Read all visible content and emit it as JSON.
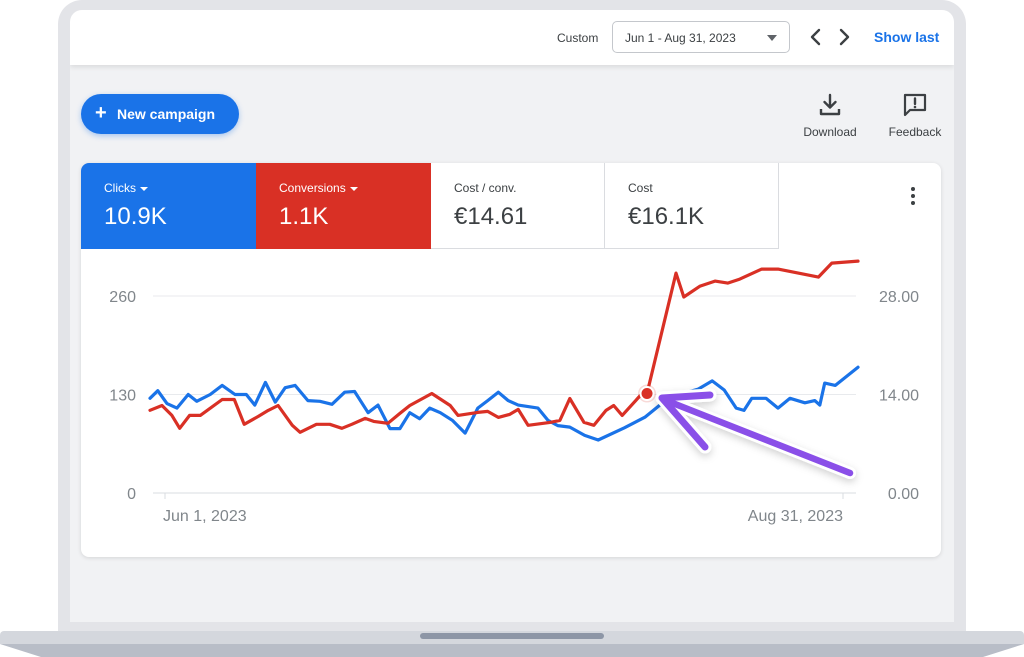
{
  "header": {
    "range_label": "Custom",
    "date_range": "Jun 1 - Aug 31, 2023",
    "show_last": "Show last"
  },
  "toolbar": {
    "new_campaign": "New campaign",
    "download": "Download",
    "feedback": "Feedback"
  },
  "metrics": [
    {
      "name": "Clicks",
      "value": "10.9K",
      "color": "#1a73e8",
      "selected": true
    },
    {
      "name": "Conversions",
      "value": "1.1K",
      "color": "#d93025",
      "selected": true
    },
    {
      "name": "Cost / conv.",
      "value": "€14.61",
      "selected": false
    },
    {
      "name": "Cost",
      "value": "€16.1K",
      "selected": false
    }
  ],
  "chart_data": {
    "type": "line",
    "title": "",
    "x_start_label": "Jun 1, 2023",
    "x_end_label": "Aug 31, 2023",
    "x_range": [
      "2023-06-01",
      "2023-08-31"
    ],
    "y_left": {
      "ticks": [
        "0",
        "130",
        "260"
      ],
      "range": [
        0,
        260
      ],
      "series": "Clicks"
    },
    "y_right": {
      "ticks": [
        "0.00",
        "14.00",
        "28.00"
      ],
      "range": [
        0,
        28
      ],
      "series": "Conversions"
    },
    "grid": true,
    "annotation": {
      "type": "arrow",
      "color": "#8a4fe8",
      "target_series": "Conversions",
      "target_index": 41,
      "marker_color": "#d93025"
    },
    "series": [
      {
        "name": "Clicks",
        "axis": "left",
        "color": "#1a73e8",
        "x_frac": [
          0,
          0.011,
          0.024,
          0.038,
          0.054,
          0.066,
          0.085,
          0.102,
          0.12,
          0.136,
          0.148,
          0.163,
          0.177,
          0.191,
          0.205,
          0.223,
          0.24,
          0.257,
          0.275,
          0.289,
          0.308,
          0.322,
          0.339,
          0.353,
          0.367,
          0.381,
          0.395,
          0.41,
          0.427,
          0.445,
          0.463,
          0.477,
          0.492,
          0.506,
          0.52,
          0.548,
          0.562,
          0.576,
          0.593,
          0.614,
          0.633,
          0.67,
          0.699,
          0.72,
          0.737,
          0.755,
          0.774,
          0.794,
          0.811,
          0.828,
          0.839,
          0.85,
          0.87,
          0.887,
          0.904,
          0.925,
          0.939,
          0.946,
          0.953,
          0.968,
          1.0
        ],
        "values": [
          125,
          135,
          118,
          112,
          130,
          121,
          130,
          142,
          130,
          130,
          116,
          146,
          120,
          139,
          142,
          122,
          121,
          117,
          133,
          134,
          106,
          116,
          85,
          85,
          106,
          98,
          112,
          106,
          96,
          79,
          112,
          122,
          133,
          122,
          116,
          112,
          96,
          89,
          87,
          76,
          70,
          86,
          100,
          116,
          129,
          132,
          137,
          148,
          136,
          112,
          109,
          125,
          125,
          112,
          125,
          119,
          122,
          116,
          145,
          142,
          166
        ]
      },
      {
        "name": "Conversions",
        "axis": "right",
        "color": "#d93025",
        "x_frac": [
          0,
          0.017,
          0.031,
          0.042,
          0.056,
          0.071,
          0.102,
          0.119,
          0.133,
          0.153,
          0.167,
          0.181,
          0.201,
          0.212,
          0.235,
          0.254,
          0.271,
          0.285,
          0.304,
          0.316,
          0.336,
          0.353,
          0.367,
          0.398,
          0.424,
          0.435,
          0.463,
          0.477,
          0.492,
          0.508,
          0.52,
          0.534,
          0.565,
          0.579,
          0.593,
          0.613,
          0.627,
          0.644,
          0.655,
          0.667,
          0.695,
          0.702,
          0.743,
          0.754,
          0.777,
          0.798,
          0.816,
          0.833,
          0.864,
          0.887,
          0.944,
          0.963,
          1.0
        ],
        "values": [
          11.76,
          12.44,
          11.03,
          9.19,
          11.03,
          11.03,
          13.29,
          13.29,
          9.76,
          10.89,
          11.74,
          12.44,
          9.62,
          8.63,
          9.76,
          9.76,
          9.19,
          9.76,
          10.61,
          10.18,
          9.9,
          11.31,
          12.44,
          14.14,
          12.44,
          11.03,
          11.46,
          11.6,
          10.75,
          11.17,
          11.88,
          9.62,
          10.04,
          10.32,
          13.43,
          10.04,
          9.62,
          11.74,
          12.44,
          11.03,
          14.14,
          14.14,
          31.25,
          27.86,
          29.41,
          30.12,
          29.84,
          30.4,
          31.82,
          31.82,
          30.69,
          32.68,
          32.96
        ]
      }
    ]
  }
}
